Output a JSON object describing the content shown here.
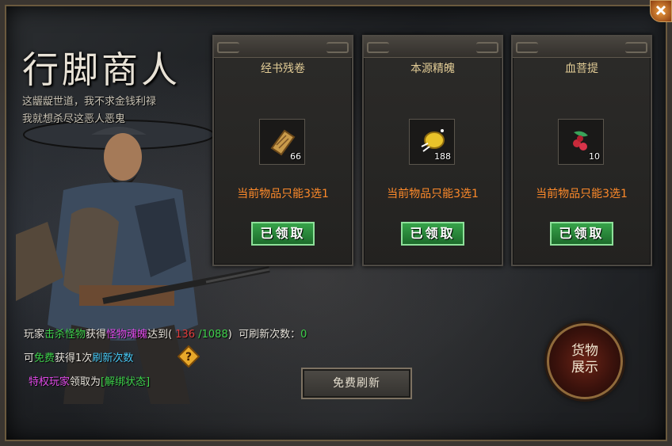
{
  "title": "行脚商人",
  "subtitle": [
    "这龌龊世道，我不求金钱利禄",
    "我就想杀尽这恶人恶鬼"
  ],
  "cards": [
    {
      "name": "经书残卷",
      "icon": "scroll-icon",
      "qty": "66",
      "rule": "当前物品只能3选1",
      "button": "已领取"
    },
    {
      "name": "本源精魄",
      "icon": "gold-essence-icon",
      "qty": "188",
      "rule": "当前物品只能3选1",
      "button": "已领取"
    },
    {
      "name": "血菩提",
      "icon": "blood-bodhi-icon",
      "qty": "10",
      "rule": "当前物品只能3选1",
      "button": "已领取"
    }
  ],
  "progress": {
    "p1": "玩家",
    "kill": "击杀怪物",
    "p2": "获得",
    "soul": "怪物魂魄",
    "p3": "达到(",
    "current": "136",
    "sep": "/",
    "max": "1088",
    "p4": ")",
    "refresh_label": "可刷新次数：",
    "refresh_count": "0"
  },
  "free": {
    "p1": "可",
    "free": "免费",
    "p2": "获得1次",
    "refresh": "刷新次数"
  },
  "privilege": {
    "vip": "特权玩家",
    "p1": "领取为",
    "status": "[解绑状态]"
  },
  "free_refresh_button": "免费刷新",
  "goods_button": {
    "line1": "货物",
    "line2": "展示"
  },
  "colors": {
    "green": "#3ed14b",
    "magenta": "#e04ae8",
    "red": "#e03c3c",
    "cyan": "#47c8f5",
    "orange": "#ff8a2a",
    "gold": "#e2cc96"
  }
}
